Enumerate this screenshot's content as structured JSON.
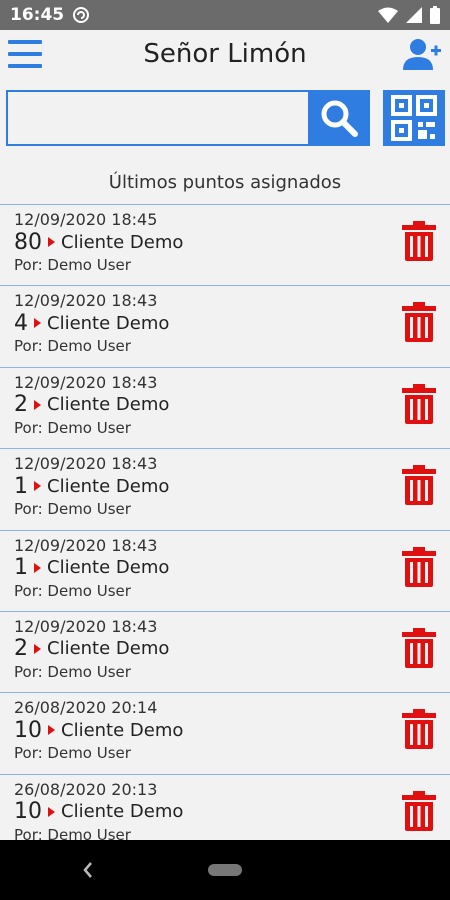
{
  "status_bar": {
    "time": "16:45",
    "icons": [
      "sync-icon",
      "wifi-icon",
      "signal-icon",
      "battery-icon"
    ]
  },
  "app_bar": {
    "title": "Señor Limón",
    "icons": [
      "menu-icon",
      "add-user-icon"
    ]
  },
  "search": {
    "value": "",
    "placeholder": "",
    "icons": [
      "search-icon",
      "qr-code-icon"
    ]
  },
  "section": {
    "title": "Últimos puntos asignados"
  },
  "entries": [
    {
      "date": "12/09/2020 18:45",
      "points": "80",
      "client": "Cliente Demo",
      "by": "Por: Demo User"
    },
    {
      "date": "12/09/2020 18:43",
      "points": "4",
      "client": "Cliente Demo",
      "by": "Por: Demo User"
    },
    {
      "date": "12/09/2020 18:43",
      "points": "2",
      "client": "Cliente Demo",
      "by": "Por: Demo User"
    },
    {
      "date": "12/09/2020 18:43",
      "points": "1",
      "client": "Cliente Demo",
      "by": "Por: Demo User"
    },
    {
      "date": "12/09/2020 18:43",
      "points": "1",
      "client": "Cliente Demo",
      "by": "Por: Demo User"
    },
    {
      "date": "12/09/2020 18:43",
      "points": "2",
      "client": "Cliente Demo",
      "by": "Por: Demo User"
    },
    {
      "date": "26/08/2020 20:14",
      "points": "10",
      "client": "Cliente Demo",
      "by": "Por: Demo User"
    },
    {
      "date": "26/08/2020 20:13",
      "points": "10",
      "client": "Cliente Demo",
      "by": "Por: Demo User"
    }
  ],
  "colors": {
    "accent": "#2f7de1",
    "delete": "#e01010",
    "divider": "#8fb2ea",
    "background": "#f2f2f2",
    "status_bar": "#6b6b6b",
    "nav_bar": "#000000"
  },
  "nav_bar": {
    "icons": [
      "back-icon",
      "home-pill-icon"
    ]
  }
}
